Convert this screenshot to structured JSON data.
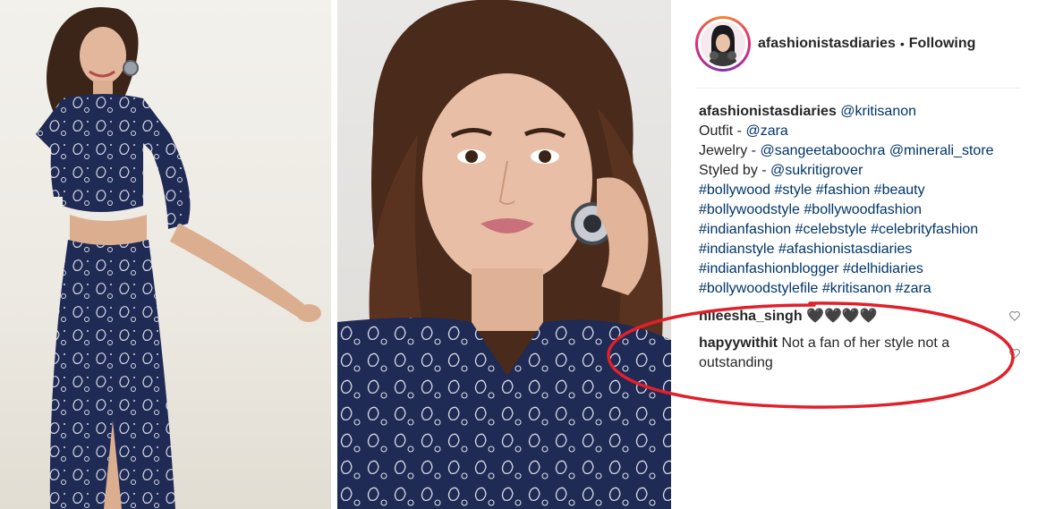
{
  "post": {
    "username": "afashionistasdiaries",
    "separator": "•",
    "follow_status": "Following"
  },
  "caption": {
    "author": "afashionistasdiaries",
    "mention_main": "@kritisanon",
    "outfit_label": "Outfit - ",
    "outfit_tag": "@zara",
    "jewelry_label": "Jewelry - ",
    "jewelry_tag_1": "@sangeetaboochra",
    "jewelry_tag_2": "@minerali_store",
    "styled_label": "Styled by - ",
    "styled_tag": "@sukritigrover",
    "hashtags": [
      "#bollywood #style #fashion #beauty",
      "#bollywoodstyle #bollywoodfashion",
      "#indianfashion #celebstyle #celebrityfashion",
      "#indianstyle #afashionistasdiaries",
      "#indianfashionblogger #delhidiaries",
      "#bollywoodstylefile #kritisanon #zara"
    ]
  },
  "comments": [
    {
      "user": "nileesha_singh",
      "text": "🖤🖤🖤🖤"
    },
    {
      "user": "hapyywithit",
      "text": "Not a fan of her style not a outstanding"
    }
  ],
  "colors": {
    "text": "#262626",
    "link": "#003569",
    "annotation": "#e0202a",
    "outfit_navy": "#1f2a55"
  }
}
